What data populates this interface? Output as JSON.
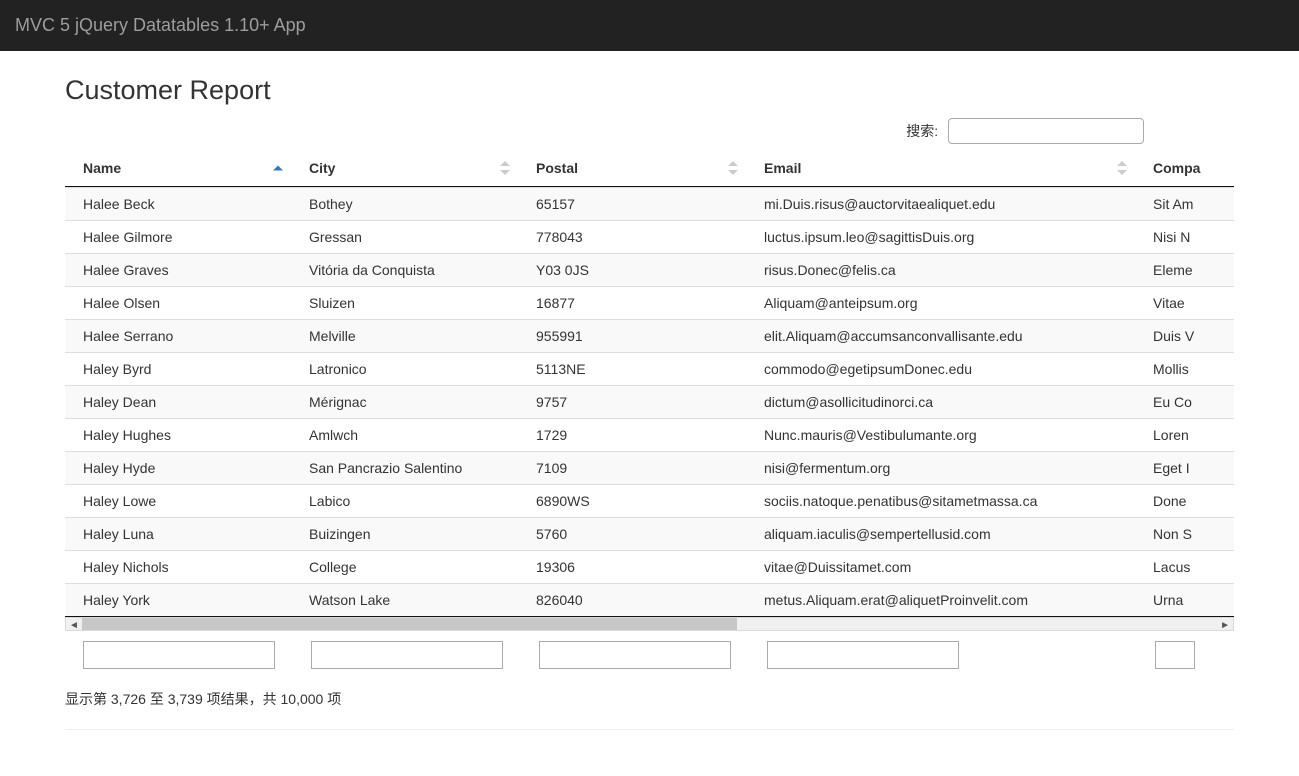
{
  "navbar": {
    "brand": "MVC 5 jQuery Datatables 1.10+ App"
  },
  "page": {
    "title": "Customer Report"
  },
  "search": {
    "label": "搜索:",
    "value": ""
  },
  "columns": {
    "name": "Name",
    "city": "City",
    "postal": "Postal",
    "email": "Email",
    "company": "Compa"
  },
  "rows": [
    {
      "name": "Halee Beck",
      "city": "Bothey",
      "postal": "65157",
      "email": "mi.Duis.risus@auctorvitaealiquet.edu",
      "company": "Sit Am"
    },
    {
      "name": "Halee Gilmore",
      "city": "Gressan",
      "postal": "778043",
      "email": "luctus.ipsum.leo@sagittisDuis.org",
      "company": "Nisi N"
    },
    {
      "name": "Halee Graves",
      "city": "Vitória da Conquista",
      "postal": "Y03 0JS",
      "email": "risus.Donec@felis.ca",
      "company": "Eleme"
    },
    {
      "name": "Halee Olsen",
      "city": "Sluizen",
      "postal": "16877",
      "email": "Aliquam@anteipsum.org",
      "company": "Vitae "
    },
    {
      "name": "Halee Serrano",
      "city": "Melville",
      "postal": "955991",
      "email": "elit.Aliquam@accumsanconvallisante.edu",
      "company": "Duis V"
    },
    {
      "name": "Haley Byrd",
      "city": "Latronico",
      "postal": "5113NE",
      "email": "commodo@egetipsumDonec.edu",
      "company": "Mollis"
    },
    {
      "name": "Haley Dean",
      "city": "Mérignac",
      "postal": "9757",
      "email": "dictum@asollicitudinorci.ca",
      "company": "Eu Co"
    },
    {
      "name": "Haley Hughes",
      "city": "Amlwch",
      "postal": "1729",
      "email": "Nunc.mauris@Vestibulumante.org",
      "company": "Loren"
    },
    {
      "name": "Haley Hyde",
      "city": "San Pancrazio Salentino",
      "postal": "7109",
      "email": "nisi@fermentum.org",
      "company": "Eget I"
    },
    {
      "name": "Haley Lowe",
      "city": "Labico",
      "postal": "6890WS",
      "email": "sociis.natoque.penatibus@sitametmassa.ca",
      "company": "Done"
    },
    {
      "name": "Haley Luna",
      "city": "Buizingen",
      "postal": "5760",
      "email": "aliquam.iaculis@sempertellusid.com",
      "company": "Non S"
    },
    {
      "name": "Haley Nichols",
      "city": "College",
      "postal": "19306",
      "email": "vitae@Duissitamet.com",
      "company": "Lacus"
    },
    {
      "name": "Haley York",
      "city": "Watson Lake",
      "postal": "826040",
      "email": "metus.Aliquam.erat@aliquetProinvelit.com",
      "company": "Urna "
    }
  ],
  "info": "显示第 3,726 至 3,739 项结果，共 10,000 项"
}
